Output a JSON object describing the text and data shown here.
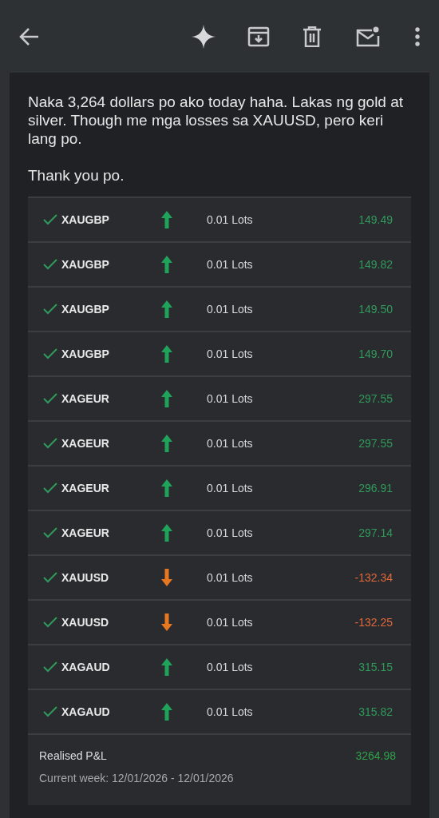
{
  "message": {
    "paragraphs": [
      "Naka 3,264 dollars po ako today haha. Lakas ng gold at silver. Though me mga losses sa XAUUSD, pero keri lang po.",
      "Thank you po."
    ]
  },
  "trades": [
    {
      "symbol": "XAUGBP",
      "kind": "up",
      "lots": "0.01 Lots",
      "pnl": "149.49"
    },
    {
      "symbol": "XAUGBP",
      "kind": "up",
      "lots": "0.01 Lots",
      "pnl": "149.82"
    },
    {
      "symbol": "XAUGBP",
      "kind": "up",
      "lots": "0.01 Lots",
      "pnl": "149.50"
    },
    {
      "symbol": "XAUGBP",
      "kind": "up",
      "lots": "0.01 Lots",
      "pnl": "149.70"
    },
    {
      "symbol": "XAGEUR",
      "kind": "up",
      "lots": "0.01 Lots",
      "pnl": "297.55"
    },
    {
      "symbol": "XAGEUR",
      "kind": "up",
      "lots": "0.01 Lots",
      "pnl": "297.55"
    },
    {
      "symbol": "XAGEUR",
      "kind": "up",
      "lots": "0.01 Lots",
      "pnl": "296.91"
    },
    {
      "symbol": "XAGEUR",
      "kind": "up",
      "lots": "0.01 Lots",
      "pnl": "297.14"
    },
    {
      "symbol": "XAUUSD",
      "kind": "down",
      "lots": "0.01 Lots",
      "pnl": "-132.34"
    },
    {
      "symbol": "XAUUSD",
      "kind": "down",
      "lots": "0.01 Lots",
      "pnl": "-132.25"
    },
    {
      "symbol": "XAGAUD",
      "kind": "up",
      "lots": "0.01 Lots",
      "pnl": "315.15"
    },
    {
      "symbol": "XAGAUD",
      "kind": "up",
      "lots": "0.01 Lots",
      "pnl": "315.82"
    }
  ],
  "summary": {
    "label": "Realised P&L",
    "value": "3264.98",
    "period": "Current week: 12/01/2026 - 12/01/2026"
  }
}
